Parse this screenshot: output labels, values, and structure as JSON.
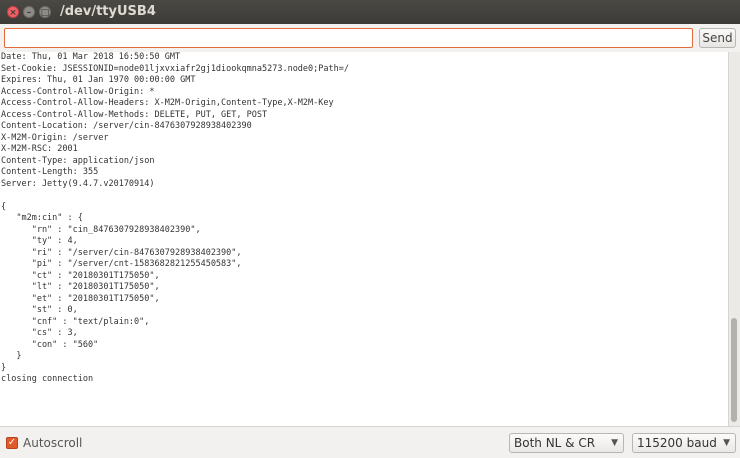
{
  "window": {
    "title": "/dev/ttyUSB4",
    "close_glyph": "×",
    "min_glyph": "–",
    "max_glyph": "□"
  },
  "input": {
    "value": "",
    "send_label": "Send"
  },
  "output": {
    "lines": [
      "Date: Thu, 01 Mar 2018 16:50:50 GMT",
      "Set-Cookie: JSESSIONID=node01ljxvxiafr2gj1diookqmna5273.node0;Path=/",
      "Expires: Thu, 01 Jan 1970 00:00:00 GMT",
      "Access-Control-Allow-Origin: *",
      "Access-Control-Allow-Headers: X-M2M-Origin,Content-Type,X-M2M-Key",
      "Access-Control-Allow-Methods: DELETE, PUT, GET, POST",
      "Content-Location: /server/cin-8476307928938402390",
      "X-M2M-Origin: /server",
      "X-M2M-RSC: 2001",
      "Content-Type: application/json",
      "Content-Length: 355",
      "Server: Jetty(9.4.7.v20170914)",
      "",
      "{",
      "   \"m2m:cin\" : {",
      "      \"rn\" : \"cin_8476307928938402390\",",
      "      \"ty\" : 4,",
      "      \"ri\" : \"/server/cin-8476307928938402390\",",
      "      \"pi\" : \"/server/cnt-1583682821255450583\",",
      "      \"ct\" : \"20180301T175050\",",
      "      \"lt\" : \"20180301T175050\",",
      "      \"et\" : \"20180301T175050\",",
      "      \"st\" : 0,",
      "      \"cnf\" : \"text/plain:0\",",
      "      \"cs\" : 3,",
      "      \"con\" : \"560\"",
      "   }",
      "}",
      "closing connection"
    ]
  },
  "footer": {
    "autoscroll_label": "Autoscroll",
    "autoscroll_checked": true,
    "line_ending": "Both NL & CR",
    "baud_rate": "115200 baud",
    "dropdown_arrow": "▼",
    "check_glyph": "✓"
  },
  "colors": {
    "accent": "#e05a2a",
    "titlebar": "#3c3b37"
  }
}
